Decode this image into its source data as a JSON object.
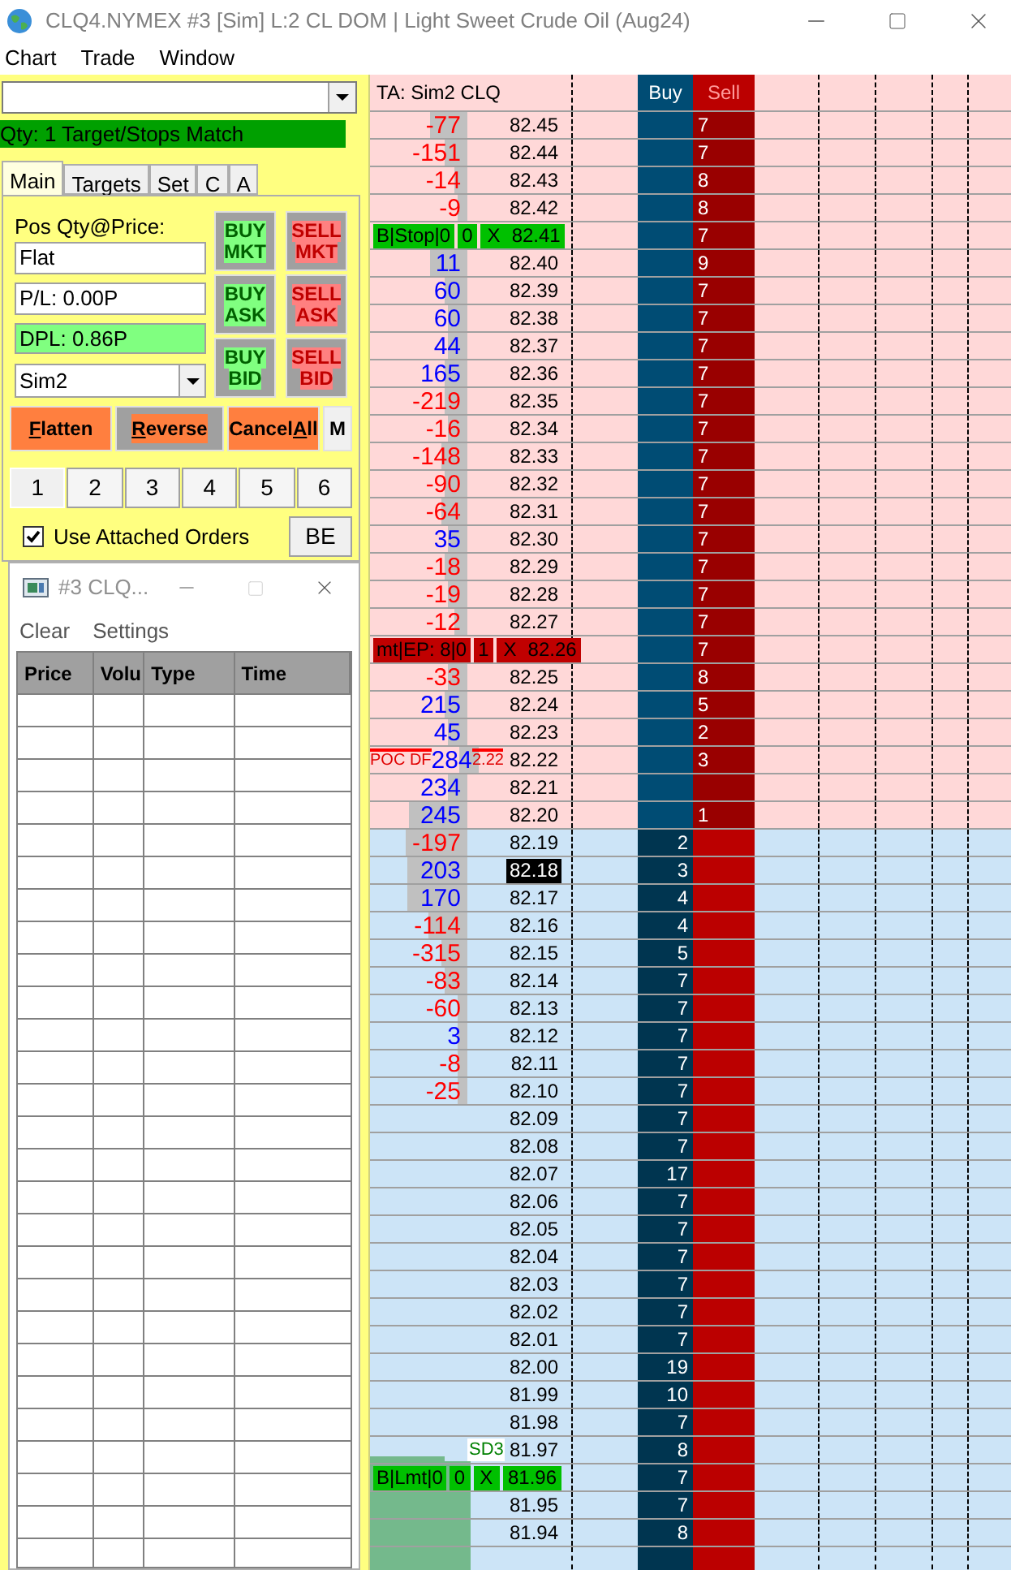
{
  "window": {
    "title": "CLQ4.NYMEX #3 [Sim]  L:2 CL DOM | Light Sweet Crude Oil (Aug24)"
  },
  "menu": [
    "Chart",
    "Trade",
    "Window"
  ],
  "order_panel": {
    "status": "Qty: 1 Target/Stops Match",
    "tabs": [
      {
        "label": "Main",
        "selected": true
      },
      {
        "label": "Targets",
        "selected": false
      },
      {
        "label": "Set",
        "selected": false
      },
      {
        "label": "C",
        "selected": false
      },
      {
        "label": "A",
        "selected": false
      }
    ],
    "position_label": "Pos Qty@Price:",
    "position": "Flat",
    "pl": "P/L: 0.00P",
    "dpl": "DPL: 0.86P",
    "account": "Sim2",
    "order_buttons": [
      {
        "top": "BUY",
        "bottom": "MKT",
        "kind": "buy"
      },
      {
        "top": "SELL",
        "bottom": "MKT",
        "kind": "sell"
      },
      {
        "top": "BUY",
        "bottom": "ASK",
        "kind": "buy"
      },
      {
        "top": "SELL",
        "bottom": "ASK",
        "kind": "sell"
      },
      {
        "top": "BUY",
        "bottom": "BID",
        "kind": "buy"
      },
      {
        "top": "SELL",
        "bottom": "BID",
        "kind": "sell"
      }
    ],
    "action_buttons": [
      {
        "key": "F",
        "after": "latten",
        "kind": "solid"
      },
      {
        "key": "R",
        "after": "everse",
        "kind": "framed"
      },
      {
        "before": "Cancel",
        "key": "A",
        "after": "ll",
        "kind": "solid"
      },
      {
        "before": "M",
        "kind": "plain"
      }
    ],
    "quantities": [
      {
        "label": "1",
        "selected": true
      },
      {
        "label": "2",
        "selected": false
      },
      {
        "label": "3",
        "selected": false
      },
      {
        "label": "4",
        "selected": false
      },
      {
        "label": "5",
        "selected": false
      },
      {
        "label": "6",
        "selected": false
      }
    ],
    "attached_orders": {
      "label": "Use Attached Orders",
      "checked": true
    },
    "be_button": "BE"
  },
  "time_sales": {
    "title": "#3 CLQ...",
    "menu": [
      "Clear",
      "Settings"
    ],
    "columns": [
      "Price",
      "Volu",
      "Type",
      "Time"
    ]
  },
  "dom": {
    "header": {
      "account": "TA: Sim2  CLQ",
      "buy": "Buy",
      "sell": "Sell"
    },
    "asks": [
      {
        "price": "82.45",
        "delta": "-77",
        "color": "#ff0000",
        "sell": "7"
      },
      {
        "price": "82.44",
        "delta": "-151",
        "color": "#ff0000",
        "sell": "7"
      },
      {
        "price": "82.43",
        "delta": "-14",
        "color": "#ff0000",
        "sell": "8"
      },
      {
        "price": "82.42",
        "delta": "-9",
        "color": "#ff0000",
        "sell": "8"
      },
      {
        "price": "82.41",
        "order": {
          "label": "B|Stop|0",
          "qty": "0",
          "cancel": "X",
          "color": "#00c000"
        },
        "sell": "7"
      },
      {
        "price": "82.40",
        "delta": "11",
        "color": "#0000ff",
        "sell": "9"
      },
      {
        "price": "82.39",
        "delta": "60",
        "color": "#0000ff",
        "sell": "7"
      },
      {
        "price": "82.38",
        "delta": "60",
        "color": "#0000ff",
        "sell": "7"
      },
      {
        "price": "82.37",
        "delta": "44",
        "color": "#0000ff",
        "sell": "7"
      },
      {
        "price": "82.36",
        "delta": "165",
        "color": "#0000ff",
        "sell": "7"
      },
      {
        "price": "82.35",
        "delta": "-219",
        "color": "#ff0000",
        "sell": "7"
      },
      {
        "price": "82.34",
        "delta": "-16",
        "color": "#ff0000",
        "sell": "7"
      },
      {
        "price": "82.33",
        "delta": "-148",
        "color": "#ff0000",
        "sell": "7"
      },
      {
        "price": "82.32",
        "delta": "-90",
        "color": "#ff0000",
        "sell": "7"
      },
      {
        "price": "82.31",
        "delta": "-64",
        "color": "#ff0000",
        "sell": "7"
      },
      {
        "price": "82.30",
        "delta": "35",
        "color": "#0000ff",
        "sell": "7"
      },
      {
        "price": "82.29",
        "delta": "-18",
        "color": "#ff0000",
        "sell": "7"
      },
      {
        "price": "82.28",
        "delta": "-19",
        "color": "#ff0000",
        "sell": "7"
      },
      {
        "price": "82.27",
        "delta": "-12",
        "color": "#ff0000",
        "sell": "7"
      },
      {
        "price": "82.26",
        "order": {
          "label": "mt|EP: 8|0",
          "qty": "1",
          "cancel": "X",
          "color": "#c00000"
        },
        "sell": "7"
      },
      {
        "price": "82.25",
        "delta": "-33",
        "color": "#ff0000",
        "sell": "8"
      },
      {
        "price": "82.24",
        "delta": "215",
        "color": "#0000ff",
        "sell": "5"
      },
      {
        "price": "82.23",
        "delta": "45",
        "color": "#0000ff",
        "sell": "2"
      },
      {
        "price": "82.22",
        "delta": "284",
        "color": "#0000ff",
        "sell": "3",
        "poc": {
          "label": "POC DF",
          "value": "2.22"
        }
      },
      {
        "price": "82.21",
        "delta": "234",
        "color": "#0000ff"
      },
      {
        "price": "82.20",
        "delta": "245",
        "color": "#0000ff",
        "sell": "1"
      }
    ],
    "bids": [
      {
        "price": "82.19",
        "delta": "-197",
        "color": "#ff0000",
        "buy": "2"
      },
      {
        "price": "82.18",
        "delta": "203",
        "color": "#0000ff",
        "buy": "3",
        "current": true
      },
      {
        "price": "82.17",
        "delta": "170",
        "color": "#0000ff",
        "buy": "4"
      },
      {
        "price": "82.16",
        "delta": "-114",
        "color": "#ff0000",
        "buy": "4"
      },
      {
        "price": "82.15",
        "delta": "-315",
        "color": "#ff0000",
        "buy": "5"
      },
      {
        "price": "82.14",
        "delta": "-83",
        "color": "#ff0000",
        "buy": "7"
      },
      {
        "price": "82.13",
        "delta": "-60",
        "color": "#ff0000",
        "buy": "7"
      },
      {
        "price": "82.12",
        "delta": "3",
        "color": "#0000ff",
        "buy": "7"
      },
      {
        "price": "82.11",
        "delta": "-8",
        "color": "#ff0000",
        "buy": "7"
      },
      {
        "price": "82.10",
        "delta": "-25",
        "color": "#ff0000",
        "buy": "7"
      },
      {
        "price": "82.09",
        "buy": "7"
      },
      {
        "price": "82.08",
        "buy": "7"
      },
      {
        "price": "82.07",
        "buy": "17"
      },
      {
        "price": "82.06",
        "buy": "7"
      },
      {
        "price": "82.05",
        "buy": "7"
      },
      {
        "price": "82.04",
        "buy": "7"
      },
      {
        "price": "82.03",
        "buy": "7"
      },
      {
        "price": "82.02",
        "buy": "7"
      },
      {
        "price": "82.01",
        "buy": "7"
      },
      {
        "price": "82.00",
        "buy": "19"
      },
      {
        "price": "81.99",
        "buy": "10"
      },
      {
        "price": "81.98",
        "buy": "7"
      },
      {
        "price": "81.97",
        "buy": "8",
        "note": "SD3"
      },
      {
        "price": "81.96",
        "order": {
          "label": "B|Lmt|0",
          "qty": "0",
          "cancel": "X",
          "color": "#00c000"
        },
        "buy": "7"
      },
      {
        "price": "81.95",
        "buy": "7"
      },
      {
        "price": "81.94",
        "buy": "8"
      }
    ]
  }
}
